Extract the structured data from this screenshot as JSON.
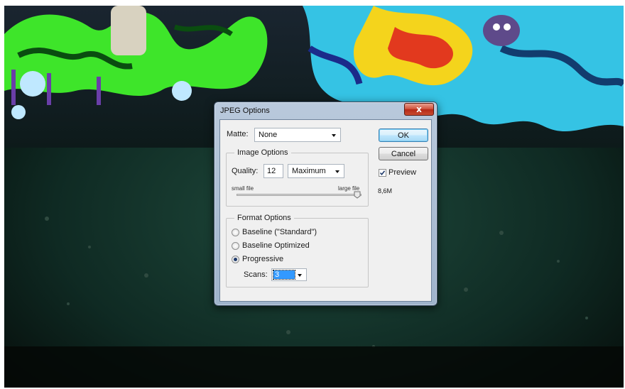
{
  "background": {
    "description_icon": "graffiti-wall-photo",
    "colors": {
      "green": "#39e62b",
      "cyan": "#37c9e8",
      "yellow": "#f5d51d",
      "red": "#e03a1f",
      "floor": "#0e2a22"
    }
  },
  "dialog": {
    "title": "JPEG Options",
    "close_label": "x",
    "matte": {
      "label": "Matte:",
      "value": "None"
    },
    "image_options": {
      "title": "Image Options",
      "quality_label": "Quality:",
      "quality_value": "12",
      "quality_preset": "Maximum",
      "slider_min_label": "small file",
      "slider_max_label": "large file",
      "slider_fraction": 1.0
    },
    "format_options": {
      "title": "Format Options",
      "options": [
        {
          "label": "Baseline (\"Standard\")",
          "selected": false
        },
        {
          "label": "Baseline Optimized",
          "selected": false
        },
        {
          "label": "Progressive",
          "selected": true
        }
      ],
      "scans_label": "Scans:",
      "scans_value": "3"
    },
    "buttons": {
      "ok": "OK",
      "cancel": "Cancel"
    },
    "preview": {
      "label": "Preview",
      "checked": true
    },
    "file_size": "8,6M"
  }
}
